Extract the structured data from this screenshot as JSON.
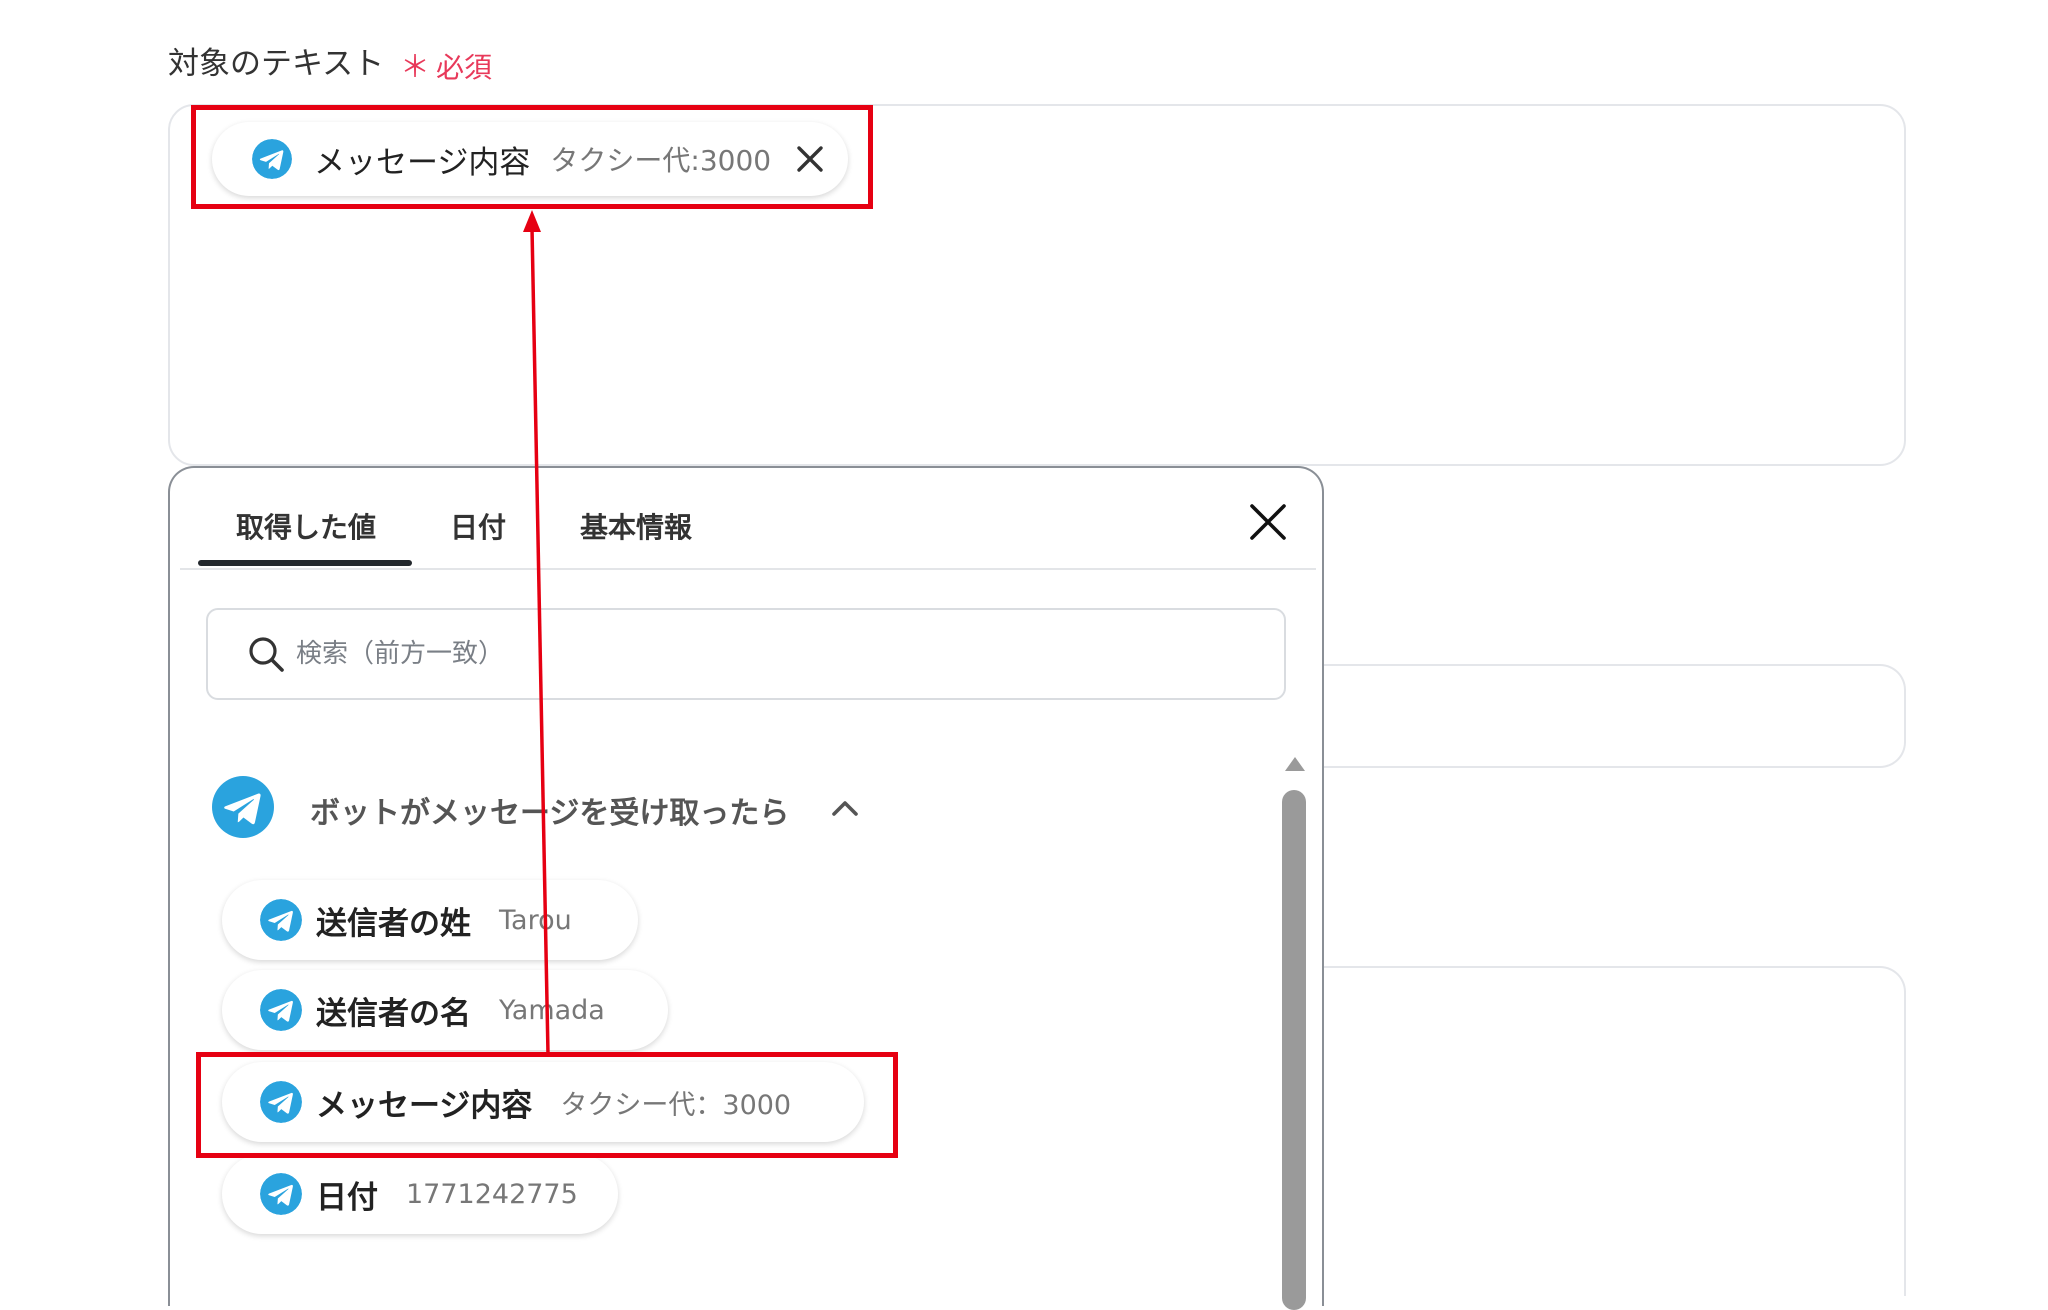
{
  "field": {
    "label": "対象のテキスト",
    "required_mark": "＊",
    "required_text": "必須"
  },
  "selected_chip": {
    "label": "メッセージ内容",
    "value": "タクシー代:3000"
  },
  "panel": {
    "tabs": [
      {
        "label": "取得した値",
        "active": true
      },
      {
        "label": "日付",
        "active": false
      },
      {
        "label": "基本情報",
        "active": false
      }
    ],
    "search_placeholder": "検索（前方一致）",
    "group_title": "ボットがメッセージを受け取ったら",
    "items": [
      {
        "label": "送信者の姓",
        "value": "Tarou"
      },
      {
        "label": "送信者の名",
        "value": "Yamada"
      },
      {
        "label": "メッセージ内容",
        "value": "タクシー代：3000"
      },
      {
        "label": "日付",
        "value": "1771242775"
      }
    ]
  },
  "colors": {
    "telegram_blue": "#2aa3de",
    "required_red": "#e8395a",
    "highlight_red": "#e60012"
  },
  "icons": {
    "app_icon": "telegram-icon",
    "remove": "close-icon",
    "panel_close": "close-icon",
    "search": "search-icon",
    "collapse": "chevron-up-icon"
  }
}
